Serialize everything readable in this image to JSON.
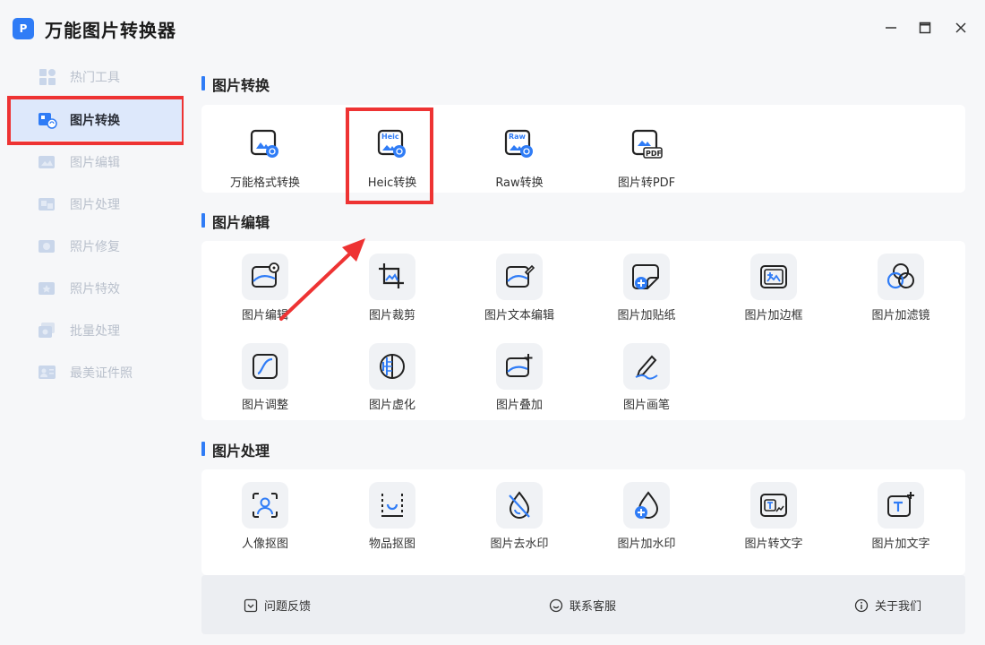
{
  "app": {
    "title": "万能图片转换器",
    "logo_text": "P"
  },
  "window_controls": {
    "minimize": "—",
    "maximize": "▢",
    "close": "✕"
  },
  "sidebar": {
    "items": [
      {
        "label": "热门工具",
        "icon": "grid-icon"
      },
      {
        "label": "图片转换",
        "icon": "image-convert-icon",
        "active": true
      },
      {
        "label": "图片编辑",
        "icon": "image-edit-icon"
      },
      {
        "label": "图片处理",
        "icon": "image-process-icon"
      },
      {
        "label": "照片修复",
        "icon": "photo-repair-icon"
      },
      {
        "label": "照片特效",
        "icon": "photo-effect-icon"
      },
      {
        "label": "批量处理",
        "icon": "batch-icon"
      },
      {
        "label": "最美证件照",
        "icon": "id-photo-icon"
      }
    ]
  },
  "sections": [
    {
      "title": "图片转换",
      "tools": [
        {
          "label": "万能格式转换",
          "icon": "format-convert-icon"
        },
        {
          "label": "Heic转换",
          "icon": "heic-icon",
          "badge": "Heic"
        },
        {
          "label": "Raw转换",
          "icon": "raw-icon",
          "badge": "Raw"
        },
        {
          "label": "图片转PDF",
          "icon": "pdf-icon",
          "badge": "PDF"
        }
      ]
    },
    {
      "title": "图片编辑",
      "tools": [
        {
          "label": "图片编辑",
          "icon": "image-settings-icon"
        },
        {
          "label": "图片裁剪",
          "icon": "crop-icon"
        },
        {
          "label": "图片文本编辑",
          "icon": "text-edit-icon"
        },
        {
          "label": "图片加贴纸",
          "icon": "sticker-icon"
        },
        {
          "label": "图片加边框",
          "icon": "frame-icon"
        },
        {
          "label": "图片加滤镜",
          "icon": "filter-icon"
        },
        {
          "label": "图片调整",
          "icon": "curve-adjust-icon"
        },
        {
          "label": "图片虚化",
          "icon": "blur-icon"
        },
        {
          "label": "图片叠加",
          "icon": "overlay-icon"
        },
        {
          "label": "图片画笔",
          "icon": "brush-icon"
        }
      ]
    },
    {
      "title": "图片处理",
      "tools": [
        {
          "label": "人像抠图",
          "icon": "portrait-cutout-icon"
        },
        {
          "label": "物品抠图",
          "icon": "object-cutout-icon"
        },
        {
          "label": "图片去水印",
          "icon": "remove-watermark-icon"
        },
        {
          "label": "图片加水印",
          "icon": "add-watermark-icon"
        },
        {
          "label": "图片转文字",
          "icon": "image-to-text-icon"
        },
        {
          "label": "图片加文字",
          "icon": "add-text-icon"
        }
      ]
    }
  ],
  "bottom_bar": {
    "feedback": "问题反馈",
    "support": "联系客服",
    "about": "关于我们"
  },
  "colors": {
    "accent": "#2f7cf6",
    "highlight": "#ee3333",
    "sidebar_active": "#dde8fb"
  }
}
